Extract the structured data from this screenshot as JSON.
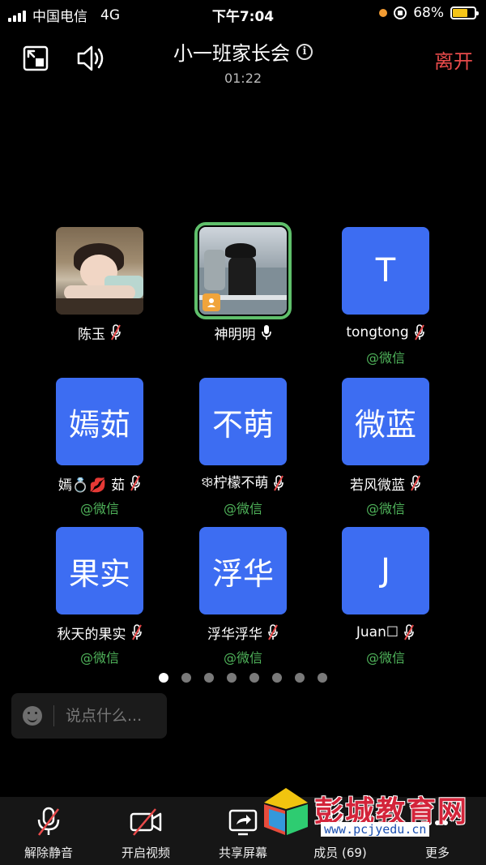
{
  "status_bar": {
    "carrier": "中国电信",
    "network": "4G",
    "time": "下午7:04",
    "battery": "68%",
    "battery_level": 0.68
  },
  "header": {
    "title": "小一班家长会",
    "timer": "01:22",
    "leave_label": "离开"
  },
  "participants": [
    {
      "avatar_text": "",
      "photo": "girl",
      "name_left": "陈玉",
      "name_right": "",
      "mic": "muted",
      "subtitle": ""
    },
    {
      "avatar_text": "",
      "photo": "sea",
      "name_left": "神明明",
      "name_right": "",
      "mic": "on",
      "speaking": true,
      "host": true,
      "subtitle": ""
    },
    {
      "avatar_text": "T",
      "name_left": "tongtong",
      "name_right": "",
      "mic": "muted",
      "subtitle": "@微信"
    },
    {
      "avatar_text": "嫣茹",
      "name_left": "嫣💍💋",
      "name_right": "茹",
      "mic": "muted",
      "subtitle": "@微信"
    },
    {
      "avatar_text": "不萌",
      "name_left": "ঞ্চ柠檬不萌",
      "name_right": "",
      "mic": "muted",
      "subtitle": "@微信"
    },
    {
      "avatar_text": "微蓝",
      "name_left": "若风微蓝",
      "name_right": "",
      "mic": "muted",
      "subtitle": "@微信"
    },
    {
      "avatar_text": "果实",
      "name_left": "秋天的果实",
      "name_right": "",
      "mic": "muted",
      "subtitle": "@微信"
    },
    {
      "avatar_text": "浮华",
      "name_left": "浮华浮华",
      "name_right": "",
      "mic": "muted",
      "subtitle": "@微信"
    },
    {
      "avatar_text": "J",
      "name_left": "Juan☐",
      "name_right": "",
      "mic": "muted",
      "subtitle": "@微信"
    }
  ],
  "pagination": {
    "total": 8,
    "current": 1
  },
  "chat": {
    "placeholder": "说点什么..."
  },
  "toolbar": {
    "unmute": "解除静音",
    "video": "开启视频",
    "share": "共享屏幕",
    "members": "成员 (69)",
    "more": "更多"
  },
  "watermark": {
    "name": "彭城教育网",
    "url": "www.pcjyedu.cn"
  },
  "colors": {
    "avatar_blue": "#3d6df2",
    "wechat_green": "#4fb35a",
    "leave_red": "#e94b4b",
    "speaking_border": "#5fbf6b"
  }
}
